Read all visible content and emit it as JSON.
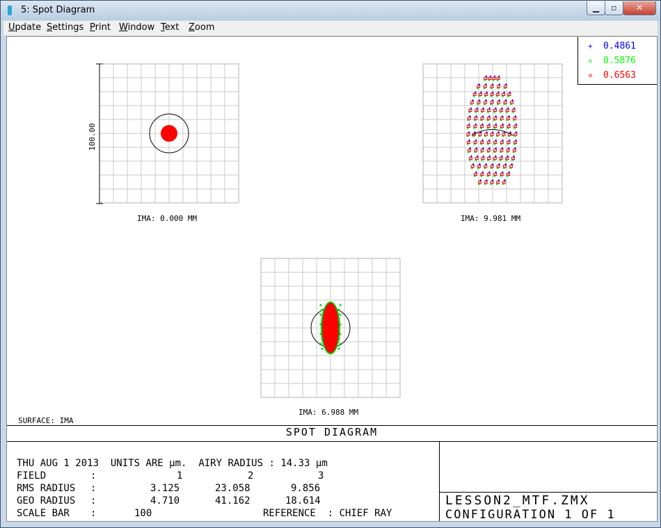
{
  "window": {
    "title": "5: Spot Diagram"
  },
  "menu": [
    "Update",
    "Settings",
    "Print",
    "Window",
    "Text",
    "Zoom"
  ],
  "legend": [
    {
      "mark": "+",
      "wavelength": "0.4861",
      "color": "#0000ff"
    },
    {
      "mark": "×",
      "wavelength": "0.5876",
      "color": "#00ff00"
    },
    {
      "mark": "¤",
      "wavelength": "0.6563",
      "color": "#ff0000"
    }
  ],
  "spots": {
    "spot1": {
      "label": "IMA: 0.000 MM"
    },
    "spot2": {
      "label": "IMA: 9.981 MM"
    },
    "spot3": {
      "label": "IMA: 6.988 MM"
    }
  },
  "scale_bar_label": "100.00",
  "surface_label": "SURFACE: IMA",
  "panel": {
    "title": "SPOT DIAGRAM",
    "date": "THU AUG 1 2013",
    "units": "UNITS ARE µm.",
    "airy": "AIRY RADIUS : 14.33 µm",
    "field_label": "FIELD",
    "rms_label": "RMS RADIUS",
    "geo_label": "GEO RADIUS",
    "scale_label": "SCALE BAR",
    "colon": ":",
    "fields": [
      "1",
      "2",
      "3"
    ],
    "rms": [
      "3.125",
      "23.058",
      "9.856"
    ],
    "geo": [
      "4.710",
      "41.162",
      "18.614"
    ],
    "scale_bar": "100",
    "reference": "REFERENCE  : CHIEF RAY",
    "lens": "LESSON2_MTF.ZMX",
    "configuration": "CONFIGURATION 1 OF 1"
  },
  "colors": {
    "ray_blue": "#0000ff",
    "ray_green": "#00c800",
    "ray_red": "#ff0000",
    "grid": "#c8c8c8"
  }
}
